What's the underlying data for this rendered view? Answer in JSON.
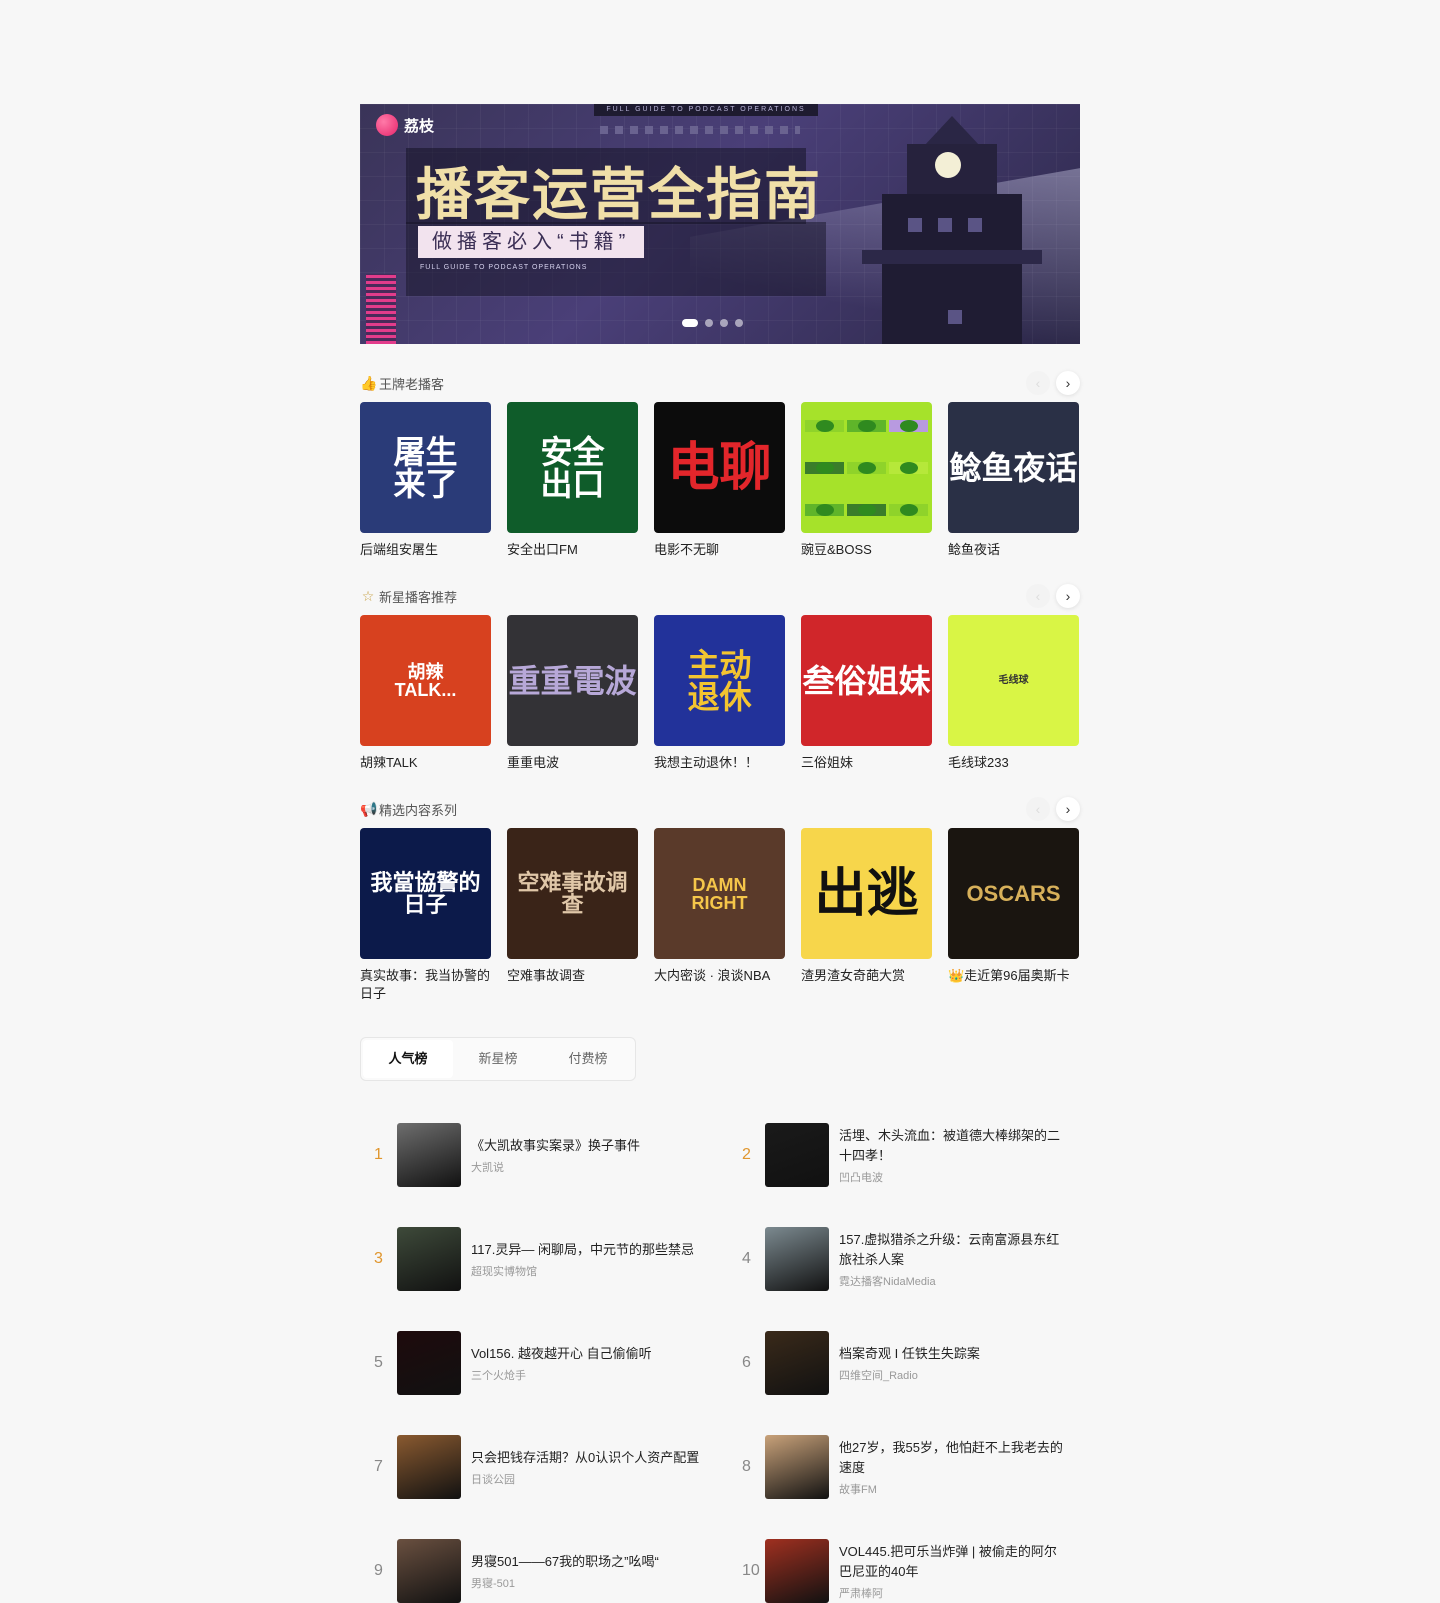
{
  "banner": {
    "logo": "荔枝",
    "title": "播客运营全指南",
    "subtitle": "做播客必入“书籍”",
    "tiny_text": "FULL GUIDE TO PODCAST OPERATIONS",
    "top_strip": "FULL GUIDE TO PODCAST OPERATIONS",
    "slides": 4,
    "active_slide": 1
  },
  "sections": [
    {
      "title": "王牌老播客",
      "icon": "thumbs-up-icon",
      "items": [
        {
          "name": "后端组安屠生",
          "cover_text": "屠生\n来了",
          "bg": "#2a3b78",
          "fg": "#ffffff"
        },
        {
          "name": "安全出口FM",
          "cover_text": "安全\n出口",
          "bg": "#0f5c2a",
          "fg": "#ffffff"
        },
        {
          "name": "电影不无聊",
          "cover_text": "电聊",
          "bg": "#0c0c0c",
          "fg": "#e3262b"
        },
        {
          "name": "豌豆&BOSS",
          "cover_text": "",
          "bg": "#a6e22a",
          "fg": "#222222"
        },
        {
          "name": "鲶鱼夜话",
          "cover_text": "鲶鱼夜话",
          "bg": "#2a3046",
          "fg": "#ffffff"
        }
      ]
    },
    {
      "title": "新星播客推荐",
      "icon": "star-icon",
      "items": [
        {
          "name": "胡辣TALK",
          "cover_text": "胡辣\nTALK...",
          "bg": "#d7411f",
          "fg": "#ffffff"
        },
        {
          "name": "重重电波",
          "cover_text": "重重電波",
          "bg": "#333236",
          "fg": "#b7a8d8"
        },
        {
          "name": "我想主动退休！！",
          "cover_text": "主动\n退休",
          "bg": "#22329a",
          "fg": "#f3c430"
        },
        {
          "name": "三俗姐妹",
          "cover_text": "叁俗姐妹",
          "bg": "#d0262a",
          "fg": "#ffffff"
        },
        {
          "name": "毛线球233",
          "cover_text": "毛线球",
          "bg": "#d9f545",
          "fg": "#333333"
        }
      ]
    },
    {
      "title": "精选内容系列",
      "icon": "megaphone-icon",
      "items": [
        {
          "name": "真实故事：我当协警的日子",
          "cover_text": "我當協警的日子",
          "bg": "#0c1a4a",
          "fg": "#ffffff"
        },
        {
          "name": "空难事故调查",
          "cover_text": "空难事故调查",
          "bg": "#3a2418",
          "fg": "#e0c7a8"
        },
        {
          "name": "大内密谈 · 浪谈NBA",
          "cover_text": "DAMN\nRIGHT",
          "bg": "#5a3a2a",
          "fg": "#f5c64a"
        },
        {
          "name": "渣男渣女奇葩大赏",
          "cover_text": "出逃",
          "bg": "#f7d64b",
          "fg": "#111111"
        },
        {
          "name": "👑走近第96届奥斯卡",
          "cover_text": "OSCARS",
          "bg": "#1a1510",
          "fg": "#d7b05a"
        }
      ]
    }
  ],
  "rank_tabs": [
    "人气榜",
    "新星榜",
    "付费榜"
  ],
  "active_tab": "人气榜",
  "rankings": [
    {
      "rank": "1",
      "title": "《大凯故事实案录》换子事件",
      "author": "大凯说",
      "bg": "#6e6e6e"
    },
    {
      "rank": "2",
      "title": "活埋、木头流血：被道德大棒绑架的二十四孝！",
      "author": "凹凸电波",
      "bg": "#1a1a1a"
    },
    {
      "rank": "3",
      "title": "117.灵异— 闲聊局，中元节的那些禁忌",
      "author": "超现实博物馆",
      "bg": "#3e4a3a"
    },
    {
      "rank": "4",
      "title": "157.虚拟猎杀之升级：云南富源县东红旅社杀人案",
      "author": "霓达播客NidaMedia",
      "bg": "#7c8a90"
    },
    {
      "rank": "5",
      "title": "Vol156. 越夜越开心 自己偷偷听",
      "author": "三个火炝手",
      "bg": "#1e0a0c"
    },
    {
      "rank": "6",
      "title": "档案奇观 I 任铁生失踪案",
      "author": "四维空间_Radio",
      "bg": "#3a2a1a"
    },
    {
      "rank": "7",
      "title": "只会把钱存活期？从0认识个人资产配置",
      "author": "日谈公园",
      "bg": "#8a5a30"
    },
    {
      "rank": "8",
      "title": "他27岁，我55岁，他怕赶不上我老去的速度",
      "author": "故事FM",
      "bg": "#c9a27a"
    },
    {
      "rank": "9",
      "title": "男寝501——67我的职场之”吆喝“",
      "author": "男寝-501",
      "bg": "#6a5040"
    },
    {
      "rank": "10",
      "title": "VOL445.把可乐当炸弹 | 被偷走的阿尔巴尼亚的40年",
      "author": "严肃棒阿",
      "bg": "#a03020"
    }
  ]
}
